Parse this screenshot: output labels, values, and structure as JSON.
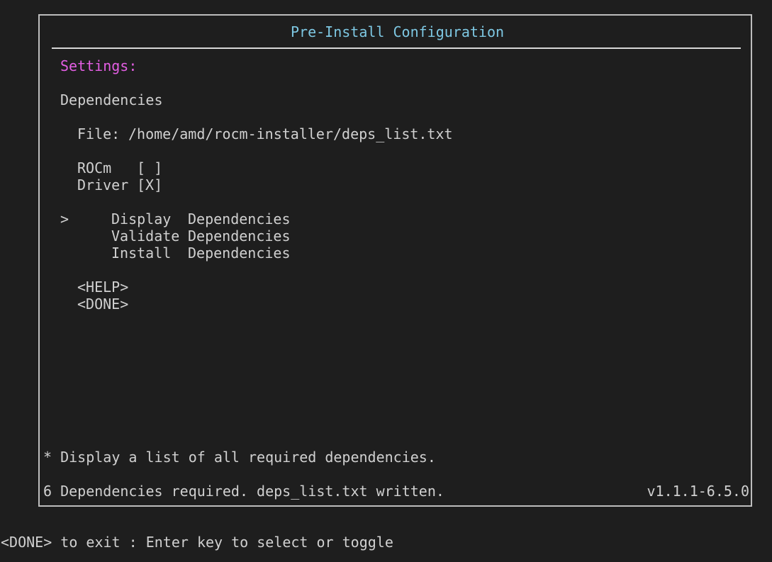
{
  "window": {
    "title": "Pre-Install Configuration"
  },
  "settings": {
    "heading": "Settings:",
    "section_title": "Dependencies",
    "file_label": "File:",
    "file_path": "/home/amd/rocm-installer/deps_list.txt",
    "toggles": [
      {
        "label": "ROCm",
        "box": "[ ]",
        "checked": false
      },
      {
        "label": "Driver",
        "box": "[X]",
        "checked": true
      }
    ],
    "menu_cursor": ">",
    "menu": [
      {
        "verb": "Display",
        "noun": "Dependencies",
        "selected": true
      },
      {
        "verb": "Validate",
        "noun": "Dependencies",
        "selected": false
      },
      {
        "verb": "Install",
        "noun": "Dependencies",
        "selected": false
      }
    ],
    "actions": {
      "help": "<HELP>",
      "done": "<DONE>"
    }
  },
  "footer": {
    "hint": "* Display a list of all required dependencies.",
    "status": "6 Dependencies required. deps_list.txt written.",
    "version": "v1.1.1-6.5.0"
  },
  "bottom_bar": {
    "text": "<DONE> to exit : Enter key to select or toggle"
  },
  "colors": {
    "background": "#1e1e1e",
    "title": "#7ec8e3",
    "settings_heading": "#e35ee3",
    "text": "#d0d0d0",
    "border": "#bdbdbd"
  }
}
